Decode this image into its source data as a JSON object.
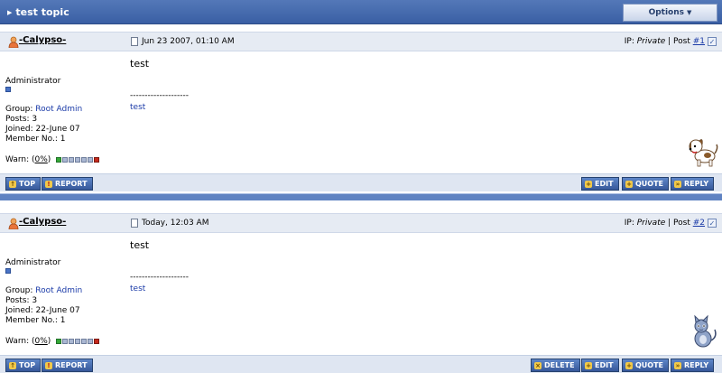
{
  "topic": {
    "title": "test topic",
    "options_label": "Options"
  },
  "posts": [
    {
      "username": "-Calypso-",
      "date": "Jun 23 2007, 01:10 AM",
      "ip_label": "IP: ",
      "ip_value": "Private",
      "post_sep": " | Post ",
      "post_no": "#1",
      "role": "Administrator",
      "group_label": "Group: ",
      "group_value": "Root Admin",
      "posts_line": "Posts: 3",
      "joined_line": "Joined: 22-June 07",
      "member_line": "Member No.: 1",
      "warn_label": "Warn: (",
      "warn_pct": "0%",
      "warn_close": ")",
      "message": "test",
      "sig_sep": "--------------------",
      "sig_text": "test",
      "buttons_left": [
        "TOP",
        "REPORT"
      ],
      "buttons_right": [
        "EDIT",
        "QUOTE",
        "REPLY"
      ]
    },
    {
      "username": "-Calypso-",
      "date": "Today, 12:03 AM",
      "ip_label": "IP: ",
      "ip_value": "Private",
      "post_sep": " | Post ",
      "post_no": "#2",
      "role": "Administrator",
      "group_label": "Group: ",
      "group_value": "Root Admin",
      "posts_line": "Posts: 3",
      "joined_line": "Joined: 22-June 07",
      "member_line": "Member No.: 1",
      "warn_label": "Warn: (",
      "warn_pct": "0%",
      "warn_close": ")",
      "message": "test",
      "sig_sep": "--------------------",
      "sig_text": "test",
      "buttons_left": [
        "TOP",
        "REPORT"
      ],
      "buttons_right": [
        "DELETE",
        "EDIT",
        "QUOTE",
        "REPLY"
      ]
    }
  ],
  "colors": {
    "header_blue": "#3a5fa4",
    "link_blue": "#1b3ba8",
    "warn_green": "#35a836",
    "warn_red": "#c42a1c"
  },
  "icons": {
    "topic_arrow": "right-triangle-icon",
    "user": "user-icon",
    "post_date": "document-icon",
    "selected": "checkbox-icon",
    "post1_avatar": "dog-icon",
    "post2_avatar": "cat-icon"
  }
}
